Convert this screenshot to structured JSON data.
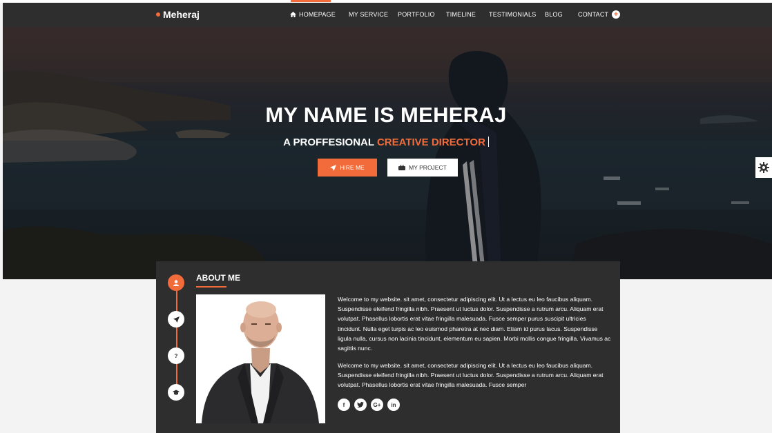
{
  "brand": {
    "name": "Meheraj"
  },
  "nav": {
    "items": [
      {
        "label": "HOMEPAGE",
        "icon": "home-icon",
        "active": true
      },
      {
        "label": "MY SERVICE"
      },
      {
        "label": "PORTFOLIO"
      },
      {
        "label": "TIMELINE"
      },
      {
        "label": "TESTIMONIALS"
      },
      {
        "label": "BLOG"
      },
      {
        "label": "CONTACT"
      }
    ],
    "plus_symbol": "+"
  },
  "hero": {
    "title": "MY NAME IS MEHERAJ",
    "subtitle_prefix": "A PROFFESIONAL ",
    "subtitle_accent": "CREATIVE DIRECTOR",
    "hire_label": "HIRE ME",
    "project_label": "MY PROJECT"
  },
  "about": {
    "title": "ABOUT ME",
    "timeline_icons": [
      "user-icon",
      "rocket-icon",
      "question-icon",
      "graduation-cap-icon"
    ],
    "question_glyph": "?",
    "paragraph1": "Welcome to my website. sit amet, consectetur adipiscing elit. Ut a lectus eu leo faucibus aliquam. Suspendisse eleifend fringilla nibh. Praesent ut luctus dolor. Suspendisse a rutrum arcu. Aliquam erat volutpat. Phasellus lobortis erat vitae fringilla malesuada. Fusce semper purus suscipit ultricies tincidunt. Nulla eget turpis ac leo euismod pharetra at nec diam. Etiam id purus lacus. Suspendisse ligula nulla, cursus non lacinia tincidunt, elementum eu sapien. Morbi mollis congue fringilla. Vivamus ac sagittis nunc.",
    "paragraph2": "Welcome to my website. sit amet, consectetur adipiscing elit. Ut a lectus eu leo faucibus aliquam. Suspendisse eleifend fringilla nibh. Praesent ut luctus dolor. Suspendisse a rutrum arcu. Aliquam erat volutpat. Phasellus lobortis erat vitae fringilla malesuada. Fusce semper",
    "socials": [
      {
        "name": "facebook-icon",
        "glyph": "f"
      },
      {
        "name": "twitter-icon",
        "glyph": "t"
      },
      {
        "name": "google-plus-icon",
        "glyph": "G+"
      },
      {
        "name": "linkedin-icon",
        "glyph": "in"
      }
    ]
  },
  "colors": {
    "accent": "#f26b3a",
    "panel": "#2f2e2e",
    "navbar": "#2f2e2e"
  }
}
